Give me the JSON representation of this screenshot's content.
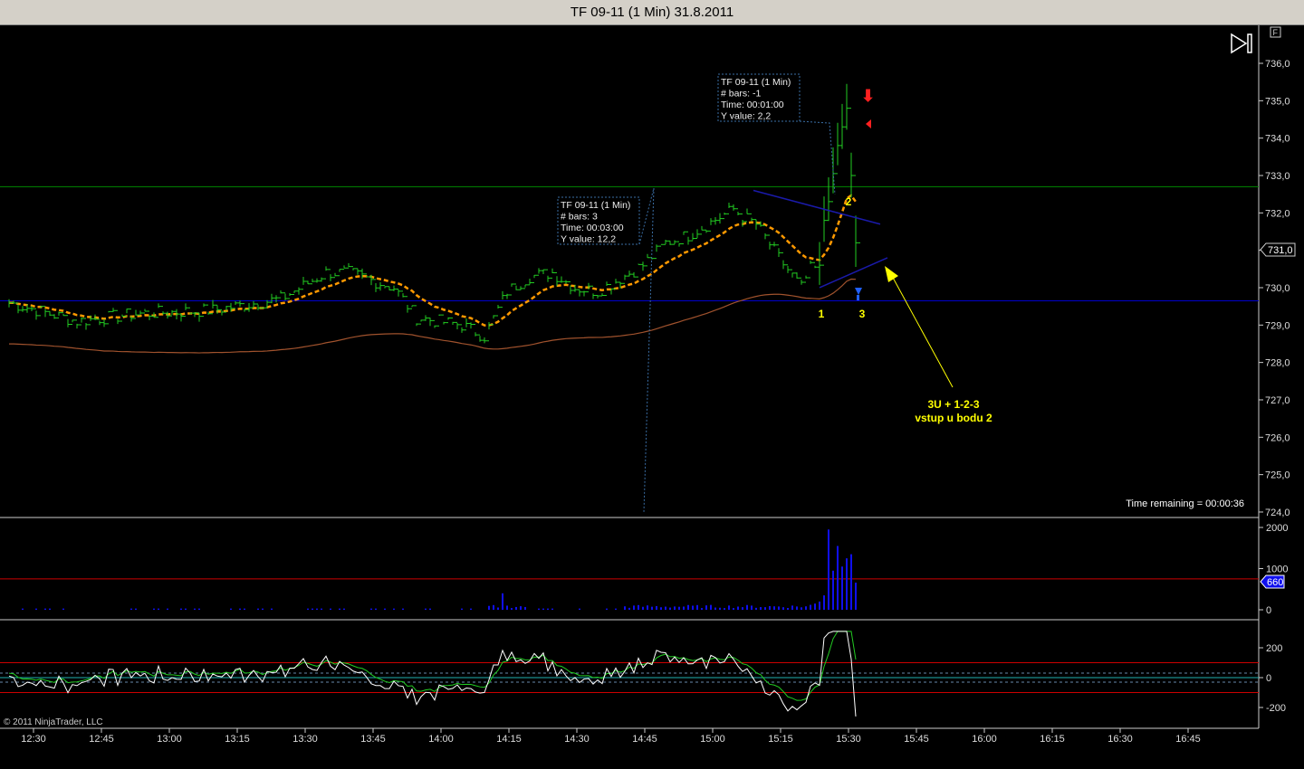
{
  "window": {
    "title": "TF 09-11 (1 Min)  31.8.2011"
  },
  "badges": {
    "f": "F",
    "copyright": "© 2011 NinjaTrader, LLC",
    "time_remaining": "Time remaining = 00:00:36"
  },
  "tooltips": [
    {
      "lines": [
        "TF 09-11 (1 Min)",
        "# bars:   3",
        "Time:     00:03:00",
        "Y value: 12,2"
      ]
    },
    {
      "lines": [
        "TF 09-11 (1 Min)",
        "# bars:   -1",
        "Time:     00:01:00",
        "Y value: 2,2"
      ]
    }
  ],
  "annotations": {
    "p1": "1",
    "p2": "2",
    "p3": "3",
    "note1": "3U + 1-2-3",
    "note2": "vstup u bodu 2"
  },
  "colors": {
    "price": "#22cc22",
    "ema_fast": "#ff9900",
    "ema_slow": "#a0522d",
    "hline_green": "#008800",
    "hline_blue": "#0000cc",
    "volume": "#1010ee",
    "osc_white": "#ffffff",
    "osc_green": "#22cc22",
    "annotation": "#ffff00"
  },
  "chart_data": [
    {
      "type": "line",
      "title": "TF 09-11 (1 Min) price",
      "ylim": [
        724,
        736.5
      ],
      "y_ticks": [
        "736,0",
        "735,0",
        "734,0",
        "733,0",
        "732,0",
        "731,0",
        "730,0",
        "729,0",
        "728,0",
        "727,0",
        "726,0",
        "725,0",
        "724,0"
      ],
      "last_price_label": "731,0",
      "x_ticks": [
        "12:30",
        "12:45",
        "13:00",
        "13:15",
        "13:30",
        "13:45",
        "14:00",
        "14:15",
        "14:30",
        "14:45",
        "15:00",
        "15:15",
        "15:30",
        "15:45",
        "16:00",
        "16:15",
        "16:30",
        "16:45"
      ],
      "x_minutes": [
        0,
        15,
        28,
        45,
        60,
        70,
        75,
        85,
        90,
        100,
        105,
        110,
        115,
        120,
        125,
        130,
        140,
        145,
        150,
        160,
        162,
        165,
        170,
        175,
        177,
        179,
        180,
        181,
        183,
        185,
        186,
        187
      ],
      "close": [
        729.6,
        729.1,
        729.3,
        729.4,
        729.7,
        730.4,
        730.4,
        730.0,
        729.2,
        729.0,
        728.7,
        729.9,
        730.3,
        730.4,
        730.0,
        729.9,
        730.6,
        731.2,
        731.4,
        732.1,
        731.9,
        731.7,
        730.8,
        730.0,
        730.5,
        730.6,
        731.8,
        732.3,
        733.8,
        734.8,
        733.0,
        731.2
      ],
      "horizontal_lines": [
        732.7,
        729.65
      ]
    },
    {
      "type": "bar",
      "title": "Volume",
      "ylim": [
        0,
        2200
      ],
      "y_ticks": [
        "2000",
        "1000",
        "0"
      ],
      "last_value_label": "660",
      "reference_line": 750,
      "tail_values": [
        120,
        150,
        200,
        350,
        1950,
        950,
        1550,
        1050,
        1250,
        1350,
        660
      ]
    },
    {
      "type": "line",
      "title": "Oscillator",
      "ylim": [
        -280,
        330
      ],
      "y_ticks": [
        "200",
        "0",
        "-200"
      ],
      "reference_lines": [
        100,
        -100
      ],
      "dotted_lines": [
        30,
        -30
      ]
    }
  ]
}
